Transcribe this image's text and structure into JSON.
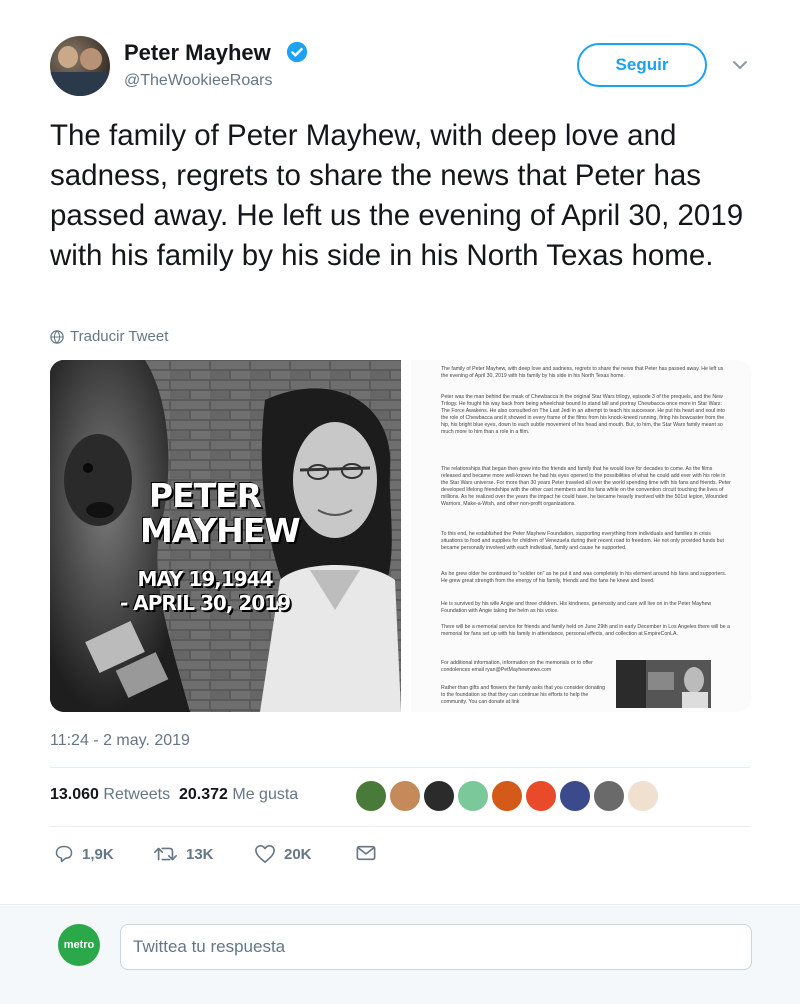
{
  "author": {
    "name": "Peter Mayhew",
    "handle": "@TheWookieeRoars",
    "follow_label": "Seguir"
  },
  "tweet": {
    "text": "The family of Peter Mayhew, with deep love and sadness, regrets to share the news that Peter has passed away.  He left us the evening of April 30, 2019 with his family by his side in his North Texas home.",
    "translate_label": "Traducir Tweet",
    "timestamp": "11:24 - 2 may. 2019"
  },
  "media": {
    "poster": {
      "name_line1": "PETER",
      "name_line2": "MAYHEW",
      "date_line1": "MAY 19,1944",
      "date_line2": "- APRIL 30, 2019"
    },
    "document_paragraphs": [
      "The family of Peter Mayhew, with deep love and sadness, regrets to share the news that Peter has passed away. He left us the evening of April 30, 2019 with his family by his side in his North Texas home.",
      "Peter was the man behind the mask of Chewbacca in the original Star Wars trilogy, episode 3 of the prequels, and the New Trilogy. He fought his way back from being wheelchair bound to stand tall and portray Chewbacca once more in Star Wars: The Force Awakens. He also consulted on The Last Jedi in an attempt to teach his successor. He put his heart and soul into the role of Chewbacca and it showed in every frame of the films from his knock-kneed running, firing his bowcaster from the hip, his bright blue eyes, down to each subtle movement of his head and mouth. But, to him, the Star Wars family meant so much more to him than a role in a film.",
      "The relationships that began then grew into the friends and family that he would love for decades to come. As the films released and became more well-known he had his eyes opened to the possibilities of what he could add ever with his role in the Star Wars universe. For more than 30 years Peter traveled all over the world spending time with his fans and friends. Peter developed lifelong friendships with the other cast members and his fans while on the convention circuit touching the lives of millions. As he realized over the years the impact he could have, he became heavily involved with the 501st legion, Wounded Warriors, Make-a-Wish, and other non-profit organizations.",
      "To this end, he established the Peter Mayhew Foundation, supporting everything from individuals and families in crisis situations to food and supplies for children of Venezuela during their recent road to freedom. He not only provided funds but became personally involved with each individual, family and cause he supported.",
      "As he grew older he continued to \"soldier on\" as he put it and was completely in his element around his fans and supporters. He grew great strength from the energy of his family, friends and the fans he knew and loved.",
      "He is survived by his wife Angie and three children. His kindness, generosity and care will live on in the Peter Mayhew Foundation with Angie taking the helm as his voice.",
      "There will be a memorial service for friends and family held on June 29th and in early December in Los Angeles there will be a memorial for fans set up with his family in attendance, personal effects, and collection at EmpireConLA.",
      "For additional information, information on the memorials or to offer condolences email ryan@PetMayhewnews.com",
      "Rather than gifts and flowers the family asks that you consider donating to the foundation so that they can continue his efforts to help the community. You can donate at link"
    ]
  },
  "stats": {
    "retweets_count": "13.060",
    "retweets_label": "Retweets",
    "likes_count": "20.372",
    "likes_label": "Me gusta"
  },
  "actions": {
    "reply_count": "1,9K",
    "retweet_count": "13K",
    "like_count": "20K"
  },
  "reply_box": {
    "avatar_text": "metro",
    "placeholder": "Twittea tu respuesta"
  },
  "colors": {
    "accent": "#1da1f2",
    "text": "#14171a",
    "secondary": "#657786"
  }
}
